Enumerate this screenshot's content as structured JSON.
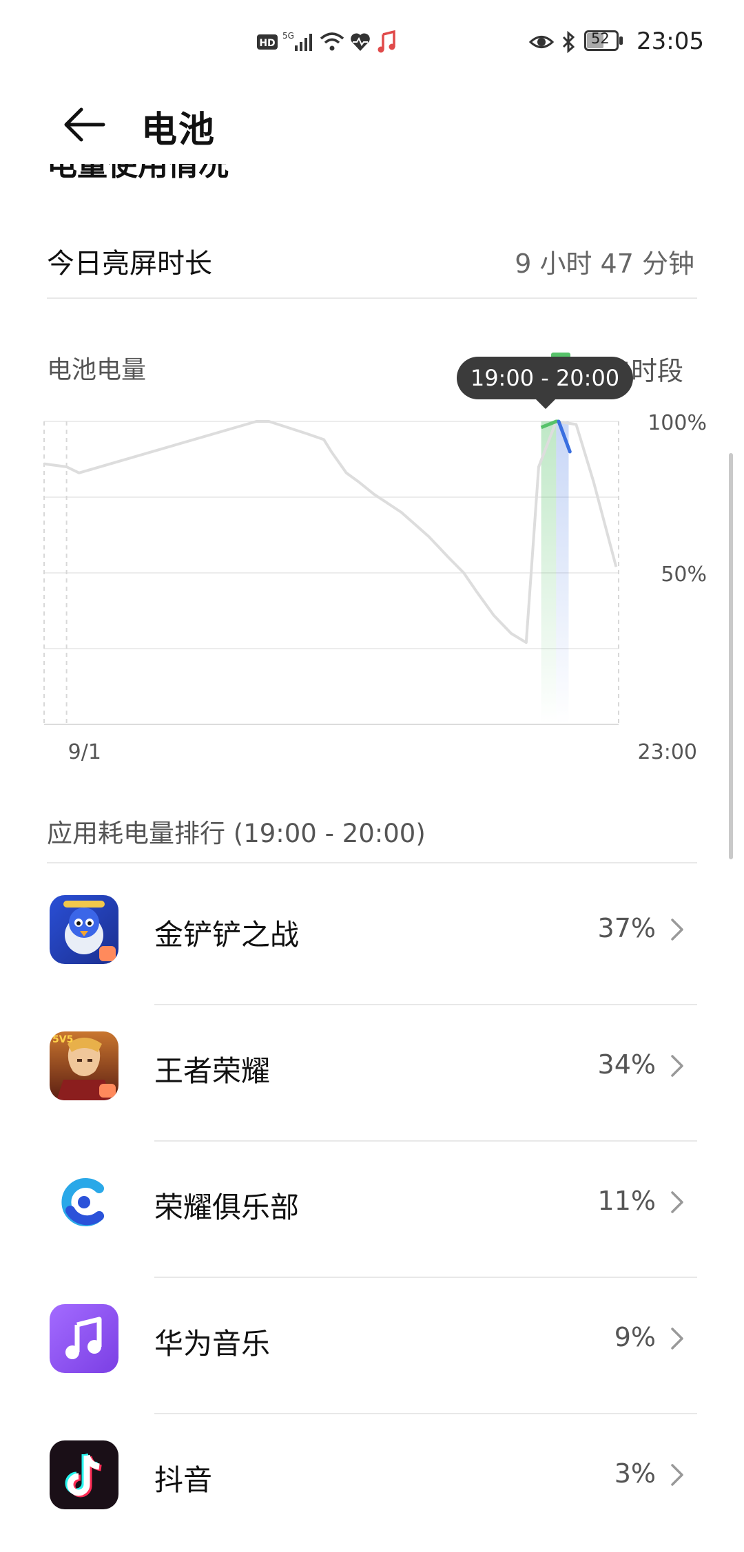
{
  "status_bar": {
    "time": "23:05",
    "battery_level": "52",
    "icons": [
      "hd-icon",
      "5g-signal-icon",
      "wifi-icon",
      "heart-rate-icon",
      "music-note-icon",
      "eye-icon",
      "bluetooth-icon",
      "battery-icon"
    ]
  },
  "header": {
    "title": "电池",
    "back_icon": "back-arrow-icon"
  },
  "section_title": "电量使用情况",
  "screen_time": {
    "label": "今日亮屏时长",
    "value": "9 小时 47 分钟"
  },
  "battery_chart": {
    "label": "电池电量",
    "legend": "充电时段",
    "tooltip": "19:00 - 20:00"
  },
  "chart_data": {
    "type": "line",
    "x_start_label": "9/1",
    "x_end_label": "23:00",
    "y_tick_labels": [
      "100%",
      "50%"
    ],
    "ylim": [
      0,
      100
    ],
    "grid": true,
    "x_hours": [
      0,
      0.9,
      1.4,
      8.5,
      9.0,
      10.5,
      11.2,
      11.5,
      12.1,
      12.6,
      13.2,
      14.3,
      15.4,
      16.2,
      16.8,
      17.3,
      18.0,
      18.7,
      19.3,
      19.8,
      20.5,
      21.3,
      22.0,
      22.9
    ],
    "y_percent": [
      86,
      85,
      83,
      100,
      100,
      96,
      94,
      90,
      83,
      80,
      76,
      70,
      62,
      55,
      50,
      44,
      36,
      30,
      27,
      85,
      100,
      99,
      80,
      52
    ],
    "charging_window": [
      19.0,
      20.0
    ],
    "highlight": {
      "charging_segment_color": "#57c26a",
      "selected_segment_color": "#3a6fe0",
      "line_color": "#dddddd"
    }
  },
  "ranking": {
    "label": "应用耗电量排行 (19:00 - 20:00)",
    "items": [
      {
        "name": "金铲铲之战",
        "percent": "37%",
        "icon": "golden-spatula-app-icon"
      },
      {
        "name": "王者荣耀",
        "percent": "34%",
        "icon": "honor-of-kings-app-icon"
      },
      {
        "name": "荣耀俱乐部",
        "percent": "11%",
        "icon": "honor-club-app-icon"
      },
      {
        "name": "华为音乐",
        "percent": "9%",
        "icon": "huawei-music-app-icon"
      },
      {
        "name": "抖音",
        "percent": "3%",
        "icon": "douyin-app-icon"
      }
    ]
  },
  "colors": {
    "accent_green": "#57c26a",
    "accent_blue": "#3a6fe0",
    "text_secondary": "#555555",
    "tooltip_bg": "#3b3b3b"
  }
}
